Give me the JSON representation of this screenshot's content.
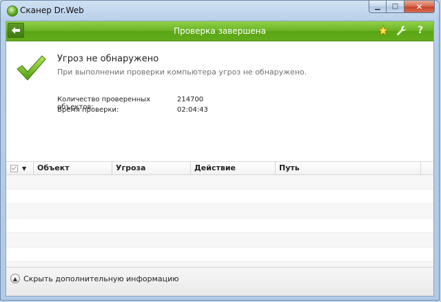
{
  "window": {
    "title": "Сканер Dr.Web",
    "buttons": {
      "minimize": "▁",
      "maximize": "□",
      "close": "✕"
    }
  },
  "toolbar": {
    "title": "Проверка завершена",
    "back_icon": "back-arrow-icon",
    "icons": [
      "star-icon",
      "wrench-icon",
      "help-icon"
    ],
    "help_glyph": "?",
    "accent_color": "#62ad1b"
  },
  "result": {
    "headline": "Угроз не обнаружено",
    "description": "При выполнении проверки компьютера угроз не обнаружено.",
    "stats": [
      {
        "label": "Количество проверенных объектов:",
        "value": "214700"
      },
      {
        "label": "Время проверки:",
        "value": "02:04:43"
      }
    ]
  },
  "table": {
    "columns": [
      "Объект",
      "Угроза",
      "Действие",
      "Путь"
    ],
    "rows": []
  },
  "footer": {
    "toggle_label": "Скрыть дополнительную информацию"
  }
}
